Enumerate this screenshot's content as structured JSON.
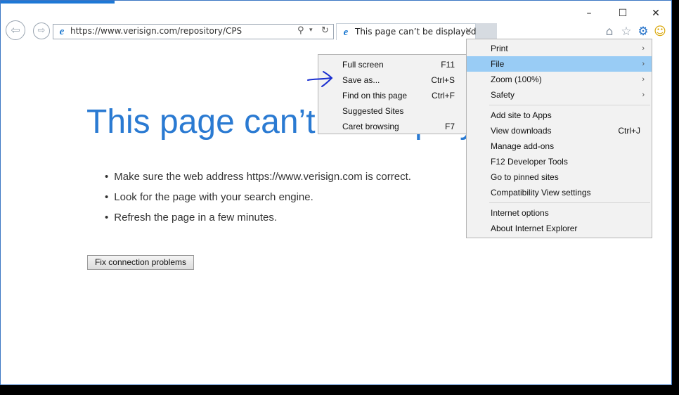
{
  "window": {
    "controls": {
      "minimize": "–",
      "maximize": "☐",
      "close": "✕"
    }
  },
  "address": {
    "url": "https://www.verisign.com/repository/CPS",
    "search_icon": "search-icon",
    "dropdown_icon": "chevron-down-icon",
    "refresh_icon": "refresh-icon"
  },
  "tab": {
    "title": "This page can’t be displayed",
    "close": "✕"
  },
  "page": {
    "heading": "This page can’t be displayed",
    "bullets": [
      "Make sure the web address https://www.verisign.com is correct.",
      "Look for the page with your search engine.",
      "Refresh the page in a few minutes."
    ],
    "fix_button": "Fix connection problems"
  },
  "file_submenu": [
    {
      "label": "Full screen",
      "shortcut": "F11"
    },
    {
      "label": "Save as...",
      "shortcut": "Ctrl+S"
    },
    {
      "label": "Find on this page",
      "shortcut": "Ctrl+F"
    },
    {
      "label": "Suggested Sites",
      "shortcut": ""
    },
    {
      "label": "Caret browsing",
      "shortcut": "F7"
    }
  ],
  "tools_menu": {
    "group1": [
      {
        "label": "Print",
        "arrow": "›"
      },
      {
        "label": "File",
        "arrow": "›"
      },
      {
        "label": "Zoom (100%)",
        "arrow": "›"
      },
      {
        "label": "Safety",
        "arrow": "›"
      }
    ],
    "group2": [
      {
        "label": "Add site to Apps",
        "shortcut": ""
      },
      {
        "label": "View downloads",
        "shortcut": "Ctrl+J"
      },
      {
        "label": "Manage add-ons",
        "shortcut": ""
      },
      {
        "label": "F12 Developer Tools",
        "shortcut": ""
      },
      {
        "label": "Go to pinned sites",
        "shortcut": ""
      },
      {
        "label": "Compatibility View settings",
        "shortcut": ""
      }
    ],
    "group3": [
      {
        "label": "Internet options"
      },
      {
        "label": "About Internet Explorer"
      }
    ]
  },
  "colors": {
    "accent": "#2a7ad2",
    "menu_highlight": "#99ccf5",
    "annotation": "#1a2fd0"
  }
}
